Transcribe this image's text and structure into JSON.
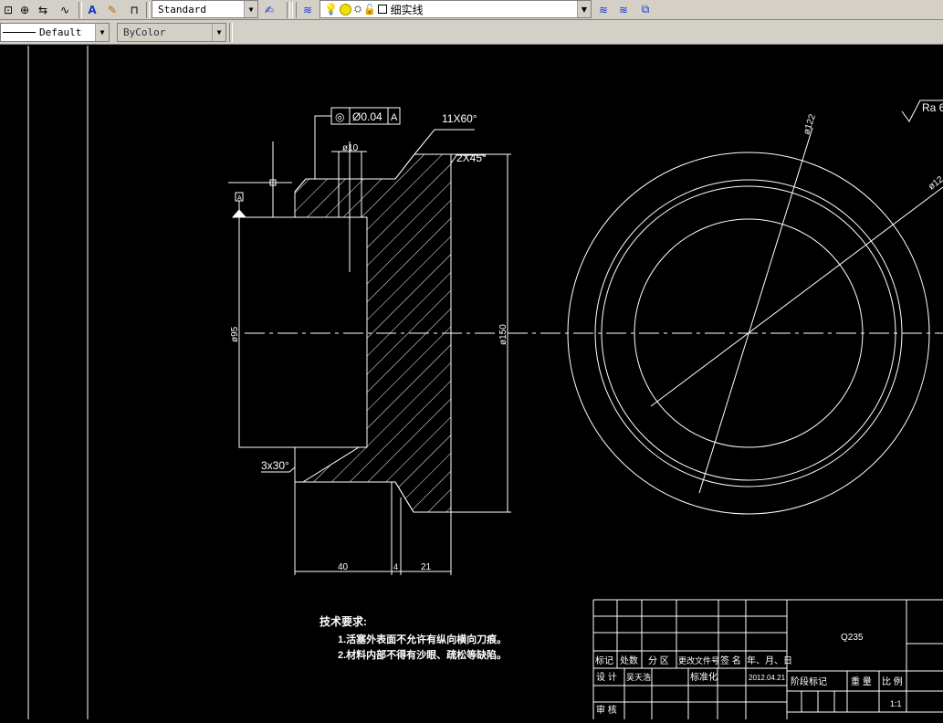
{
  "toolbar1": {
    "text_style": "Standard",
    "layer_name": "细实线",
    "icons": [
      "dim-aligned-icon",
      "dim-center-icon",
      "dim-update-icon",
      "dim-jogged-icon",
      "text-style-icon",
      "text-edit-icon",
      "dim-style-icon",
      "dim-style-manager-icon",
      "layer-manager-icon",
      "bulb-icon",
      "sun-icon",
      "lock-icon",
      "layer-color-icon",
      "layer-prev-icon",
      "layer-state-icon",
      "layer-iso-icon"
    ]
  },
  "toolbar2": {
    "linetype": "Default",
    "color": "ByColor"
  },
  "drawing": {
    "tolerance_symbol": "◎",
    "tolerance_value": "Ø0.04",
    "tolerance_datum": "A",
    "thread_callout": "11X60°",
    "chamfer_top": "2X45°",
    "chamfer_bottom": "3x30°",
    "dim_d10": "ø10",
    "dim_d95": "ø95",
    "dim_d150": "ø150",
    "dim_d122": "ø122",
    "dim_d13x": "ø12",
    "dim_40": "40",
    "dim_4": "4",
    "dim_21": "21",
    "roughness": "Ra 6",
    "datum_label": "A",
    "tech_title": "技术要求:",
    "tech_1": "1.活塞外表面不允许有纵向横向刀痕。",
    "tech_2": "2.材料内部不得有沙眼、疏松等缺陷。"
  },
  "title_block": {
    "material": "Q235",
    "h_mark": "标记",
    "h_count": "处数",
    "h_zone": "分 区",
    "h_docno": "更改文件号",
    "h_sign": "签 名",
    "h_date": "年、月、日",
    "design_label": "设 计",
    "designer": "吴天浩",
    "std_label": "标准化",
    "date": "2012.04.21",
    "stage_label": "阶段标记",
    "weight_label": "重 量",
    "scale_label": "比 例",
    "scale_value": "1:1",
    "review_label": "审 核"
  },
  "colors": {
    "toolbar": "#d4d0c8",
    "canvas": "#000000",
    "linework": "#ffffff"
  }
}
